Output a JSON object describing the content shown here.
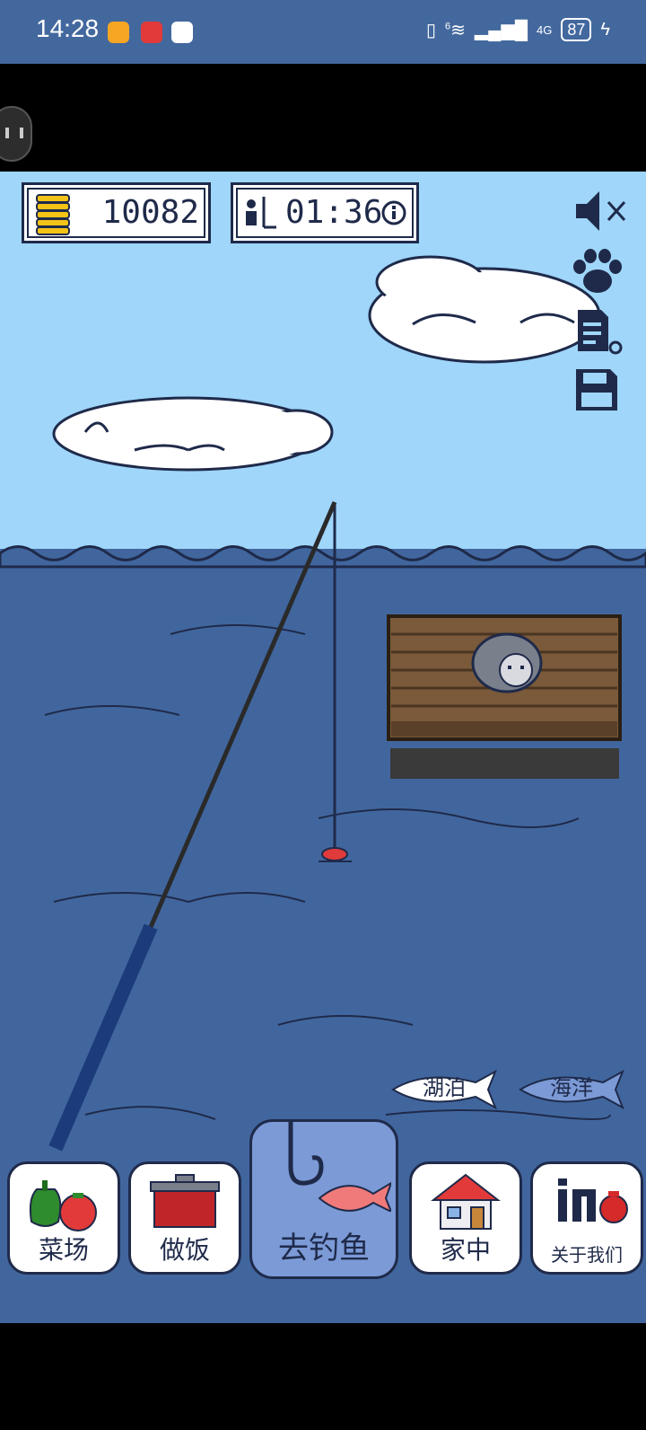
{
  "status_bar": {
    "time": "14:28",
    "network": "4G",
    "wifi_badge": "6",
    "battery": "87"
  },
  "hud": {
    "coins": "10082",
    "timer": "01:36"
  },
  "icons": {
    "coins": "coin-stack-icon",
    "timer": "fisher-icon",
    "info": "info-icon",
    "sound": "speaker-muted-icon",
    "paw": "paw-icon",
    "log": "document-icon",
    "save": "save-icon"
  },
  "places": {
    "lake": "湖泊",
    "ocean": "海洋"
  },
  "nav": [
    {
      "label": "菜场"
    },
    {
      "label": "做饭"
    },
    {
      "label": "去钓鱼"
    },
    {
      "label": "家中"
    },
    {
      "label": "关于我们"
    }
  ],
  "colors": {
    "sky": "#9fd6fa",
    "sea": "#41669e",
    "status_bar": "#43689e",
    "nav_active": "#7b9ad6",
    "outline": "#1f2a4a"
  }
}
